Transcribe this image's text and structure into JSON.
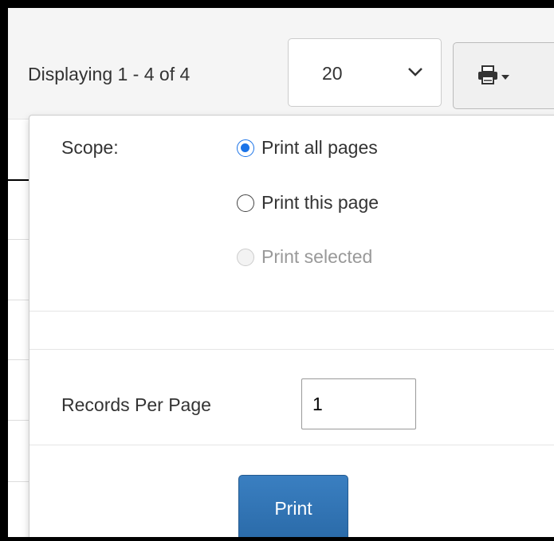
{
  "toolbar": {
    "display_text": "Displaying 1 - 4 of 4",
    "page_size_value": "20",
    "print_menu_icon": "printer-icon"
  },
  "print_dropdown": {
    "scope_label": "Scope:",
    "options": [
      {
        "label": "Print all pages",
        "checked": true,
        "disabled": false
      },
      {
        "label": "Print this page",
        "checked": false,
        "disabled": false
      },
      {
        "label": "Print selected",
        "checked": false,
        "disabled": true
      }
    ],
    "records_per_page_label": "Records Per Page",
    "records_per_page_value": "1",
    "print_button_label": "Print"
  },
  "colors": {
    "radio_checked": "#1a73e8",
    "print_button": "#2f73b5"
  }
}
